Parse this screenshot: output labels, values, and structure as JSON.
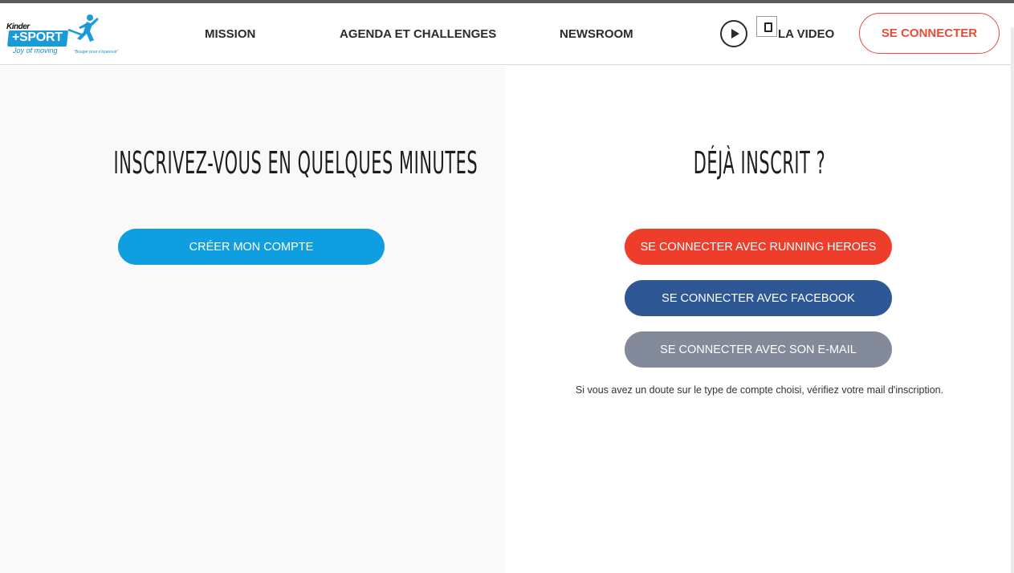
{
  "brand": {
    "kinder": "Kinder",
    "sport": "+SPORT",
    "tagline": "Joy of moving",
    "slogan": "\"Bouger pour s'épanouir\""
  },
  "nav": {
    "mission": "MISSION",
    "agenda": "AGENDA ET CHALLENGES",
    "newsroom": "NEWSROOM",
    "video": "LA VIDEO",
    "connect": "SE CONNECTER"
  },
  "signup": {
    "title": "INSCRIVEZ-VOUS EN QUELQUES MINUTES",
    "create_button": "CRÉER MON COMPTE"
  },
  "login": {
    "title": "DÉJÀ INSCRIT ?",
    "running_heroes": "SE CONNECTER AVEC RUNNING HEROES",
    "facebook": "SE CONNECTER AVEC FACEBOOK",
    "email": "SE CONNECTER AVEC SON E-MAIL",
    "note": "Si vous avez un doute sur le type de compte choisi, vérifiez votre mail d'inscription."
  },
  "colors": {
    "accent_red": "#ee3d2a",
    "accent_blue": "#0f9fe0",
    "facebook_blue": "#2d5895",
    "email_gray": "#838a99"
  },
  "icons": {
    "play": "play-icon",
    "window": "window-icon"
  }
}
